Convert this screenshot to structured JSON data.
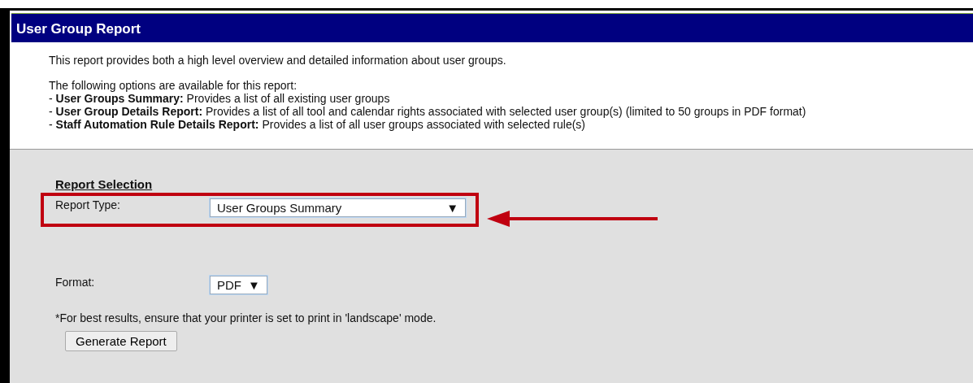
{
  "window": {
    "title": "User Group Report"
  },
  "intro": "This report provides both a high level overview and detailed information about user groups.",
  "options_heading": "The following options are available for this report:",
  "options": [
    "- **User Groups Summary:** Provides a list of all existing user groups",
    "- **User Group Details Report:** Provides a list of all tool and calendar rights associated with selected user group(s) (limited to 50 groups in PDF format)",
    "- **Staff Automation Rule Details Report:** Provides a list of all user groups associated with selected rule(s)"
  ],
  "section_title": "Report Selection",
  "report_type": {
    "label": "Report Type:",
    "value": "User Groups Summary",
    "arrow": "▼",
    "highlighted": true
  },
  "format": {
    "label": "Format:",
    "value": "PDF",
    "arrow": "▼"
  },
  "note": "*For best results, ensure that your printer is set to print in 'landscape' mode.",
  "buttons": [
    "Generate Report"
  ]
}
